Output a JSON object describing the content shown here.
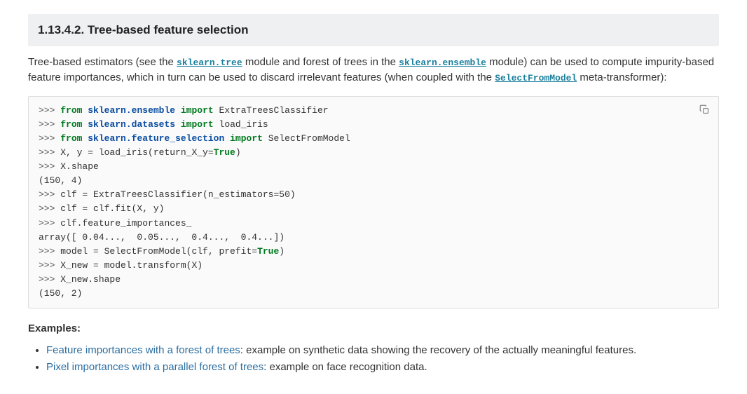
{
  "heading": "1.13.4.2. Tree-based feature selection",
  "intro": {
    "part1": "Tree-based estimators (see the ",
    "link1": "sklearn.tree",
    "part2": " module and forest of trees in the ",
    "link2": "sklearn.ensemble",
    "part3": " module) can be used to compute impurity-based feature importances, which in turn can be used to discard irrelevant features (when coupled with the ",
    "link3": "SelectFromModel",
    "part4": " meta-transformer):"
  },
  "code": {
    "l1_prompt": ">>> ",
    "l1_kw1": "from",
    "l1_mod": "sklearn.ensemble",
    "l1_kw2": "import",
    "l1_cls": "ExtraTreesClassifier",
    "l2_prompt": ">>> ",
    "l2_kw1": "from",
    "l2_mod": "sklearn.datasets",
    "l2_kw2": "import",
    "l2_cls": "load_iris",
    "l3_prompt": ">>> ",
    "l3_kw1": "from",
    "l3_mod": "sklearn.feature_selection",
    "l3_kw2": "import",
    "l3_cls": "SelectFromModel",
    "l4_prompt": ">>> ",
    "l4_code_a": "X, y = load_iris(return_X_y=",
    "l4_lit": "True",
    "l4_code_b": ")",
    "l5_prompt": ">>> ",
    "l5_code": "X.shape",
    "l6_out": "(150, 4)",
    "l7_prompt": ">>> ",
    "l7_code_a": "clf = ExtraTreesClassifier(n_estimators=",
    "l7_num": "50",
    "l7_code_b": ")",
    "l8_prompt": ">>> ",
    "l8_code": "clf = clf.fit(X, y)",
    "l9_prompt": ">>> ",
    "l9_code": "clf.feature_importances_",
    "l10_out": "array([ 0.04...,  0.05...,  0.4...,  0.4...])",
    "l11_prompt": ">>> ",
    "l11_code_a": "model = SelectFromModel(clf, prefit=",
    "l11_lit": "True",
    "l11_code_b": ")",
    "l12_prompt": ">>> ",
    "l12_code": "X_new = model.transform(X)",
    "l13_prompt": ">>> ",
    "l13_code": "X_new.shape",
    "l14_out": "(150, 2)"
  },
  "examples_label": "Examples:",
  "examples": [
    {
      "link": "Feature importances with a forest of trees",
      "desc": ": example on synthetic data showing the recovery of the actually meaningful features."
    },
    {
      "link": "Pixel importances with a parallel forest of trees",
      "desc": ": example on face recognition data."
    }
  ]
}
